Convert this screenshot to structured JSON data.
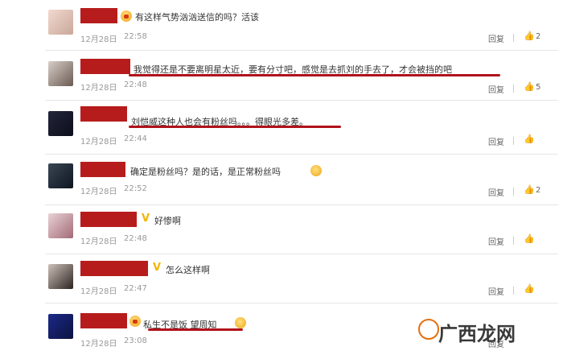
{
  "comments": [
    {
      "text": "有这样气势汹汹送信的吗？活该",
      "date": "12月28日",
      "time": "22:58",
      "reply": "回复",
      "likes": "2",
      "avatar": "female-avatar-light",
      "badge": "crown-badge"
    },
    {
      "text": "我觉得还是不要离明星太近，要有分寸吧，感觉是去抓刘的手去了，才会被挡的吧",
      "date": "12月28日",
      "time": "22:48",
      "reply": "回复",
      "likes": "5",
      "avatar": "female-avatar-dark-hair"
    },
    {
      "text": "刘恺威这种人也会有粉丝吗。。。得眼光多差。",
      "date": "12月28日",
      "time": "22:44",
      "reply": "回复",
      "likes": "",
      "avatar": "night-city-avatar"
    },
    {
      "text": "确定是粉丝吗？是的话，是正常粉丝吗",
      "date": "12月28日",
      "time": "22:52",
      "reply": "回复",
      "likes": "2",
      "avatar": "dark-landscape-avatar",
      "emoji": "laughing-emoji"
    },
    {
      "text": "好惨啊",
      "date": "12月28日",
      "time": "22:48",
      "reply": "回复",
      "likes": "",
      "avatar": "pink-portrait-avatar",
      "badge": "v-badge"
    },
    {
      "text": "怎么这样啊",
      "date": "12月28日",
      "time": "22:47",
      "reply": "回复",
      "likes": "",
      "avatar": "woman-portrait-avatar",
      "badge": "v-badge"
    },
    {
      "text": "私生不是饭 望周知",
      "date": "12月28日",
      "time": "23:08",
      "reply": "回复",
      "likes": "",
      "avatar": "blue-scene-avatar",
      "badge": "crown-badge",
      "emoji": "crying-emoji"
    }
  ],
  "watermark": {
    "text": "广西龙网",
    "logo": "site-logo-icon"
  },
  "colors": {
    "redaction": "#b71c1c",
    "underline": "#b0121b",
    "meta": "#999999"
  }
}
